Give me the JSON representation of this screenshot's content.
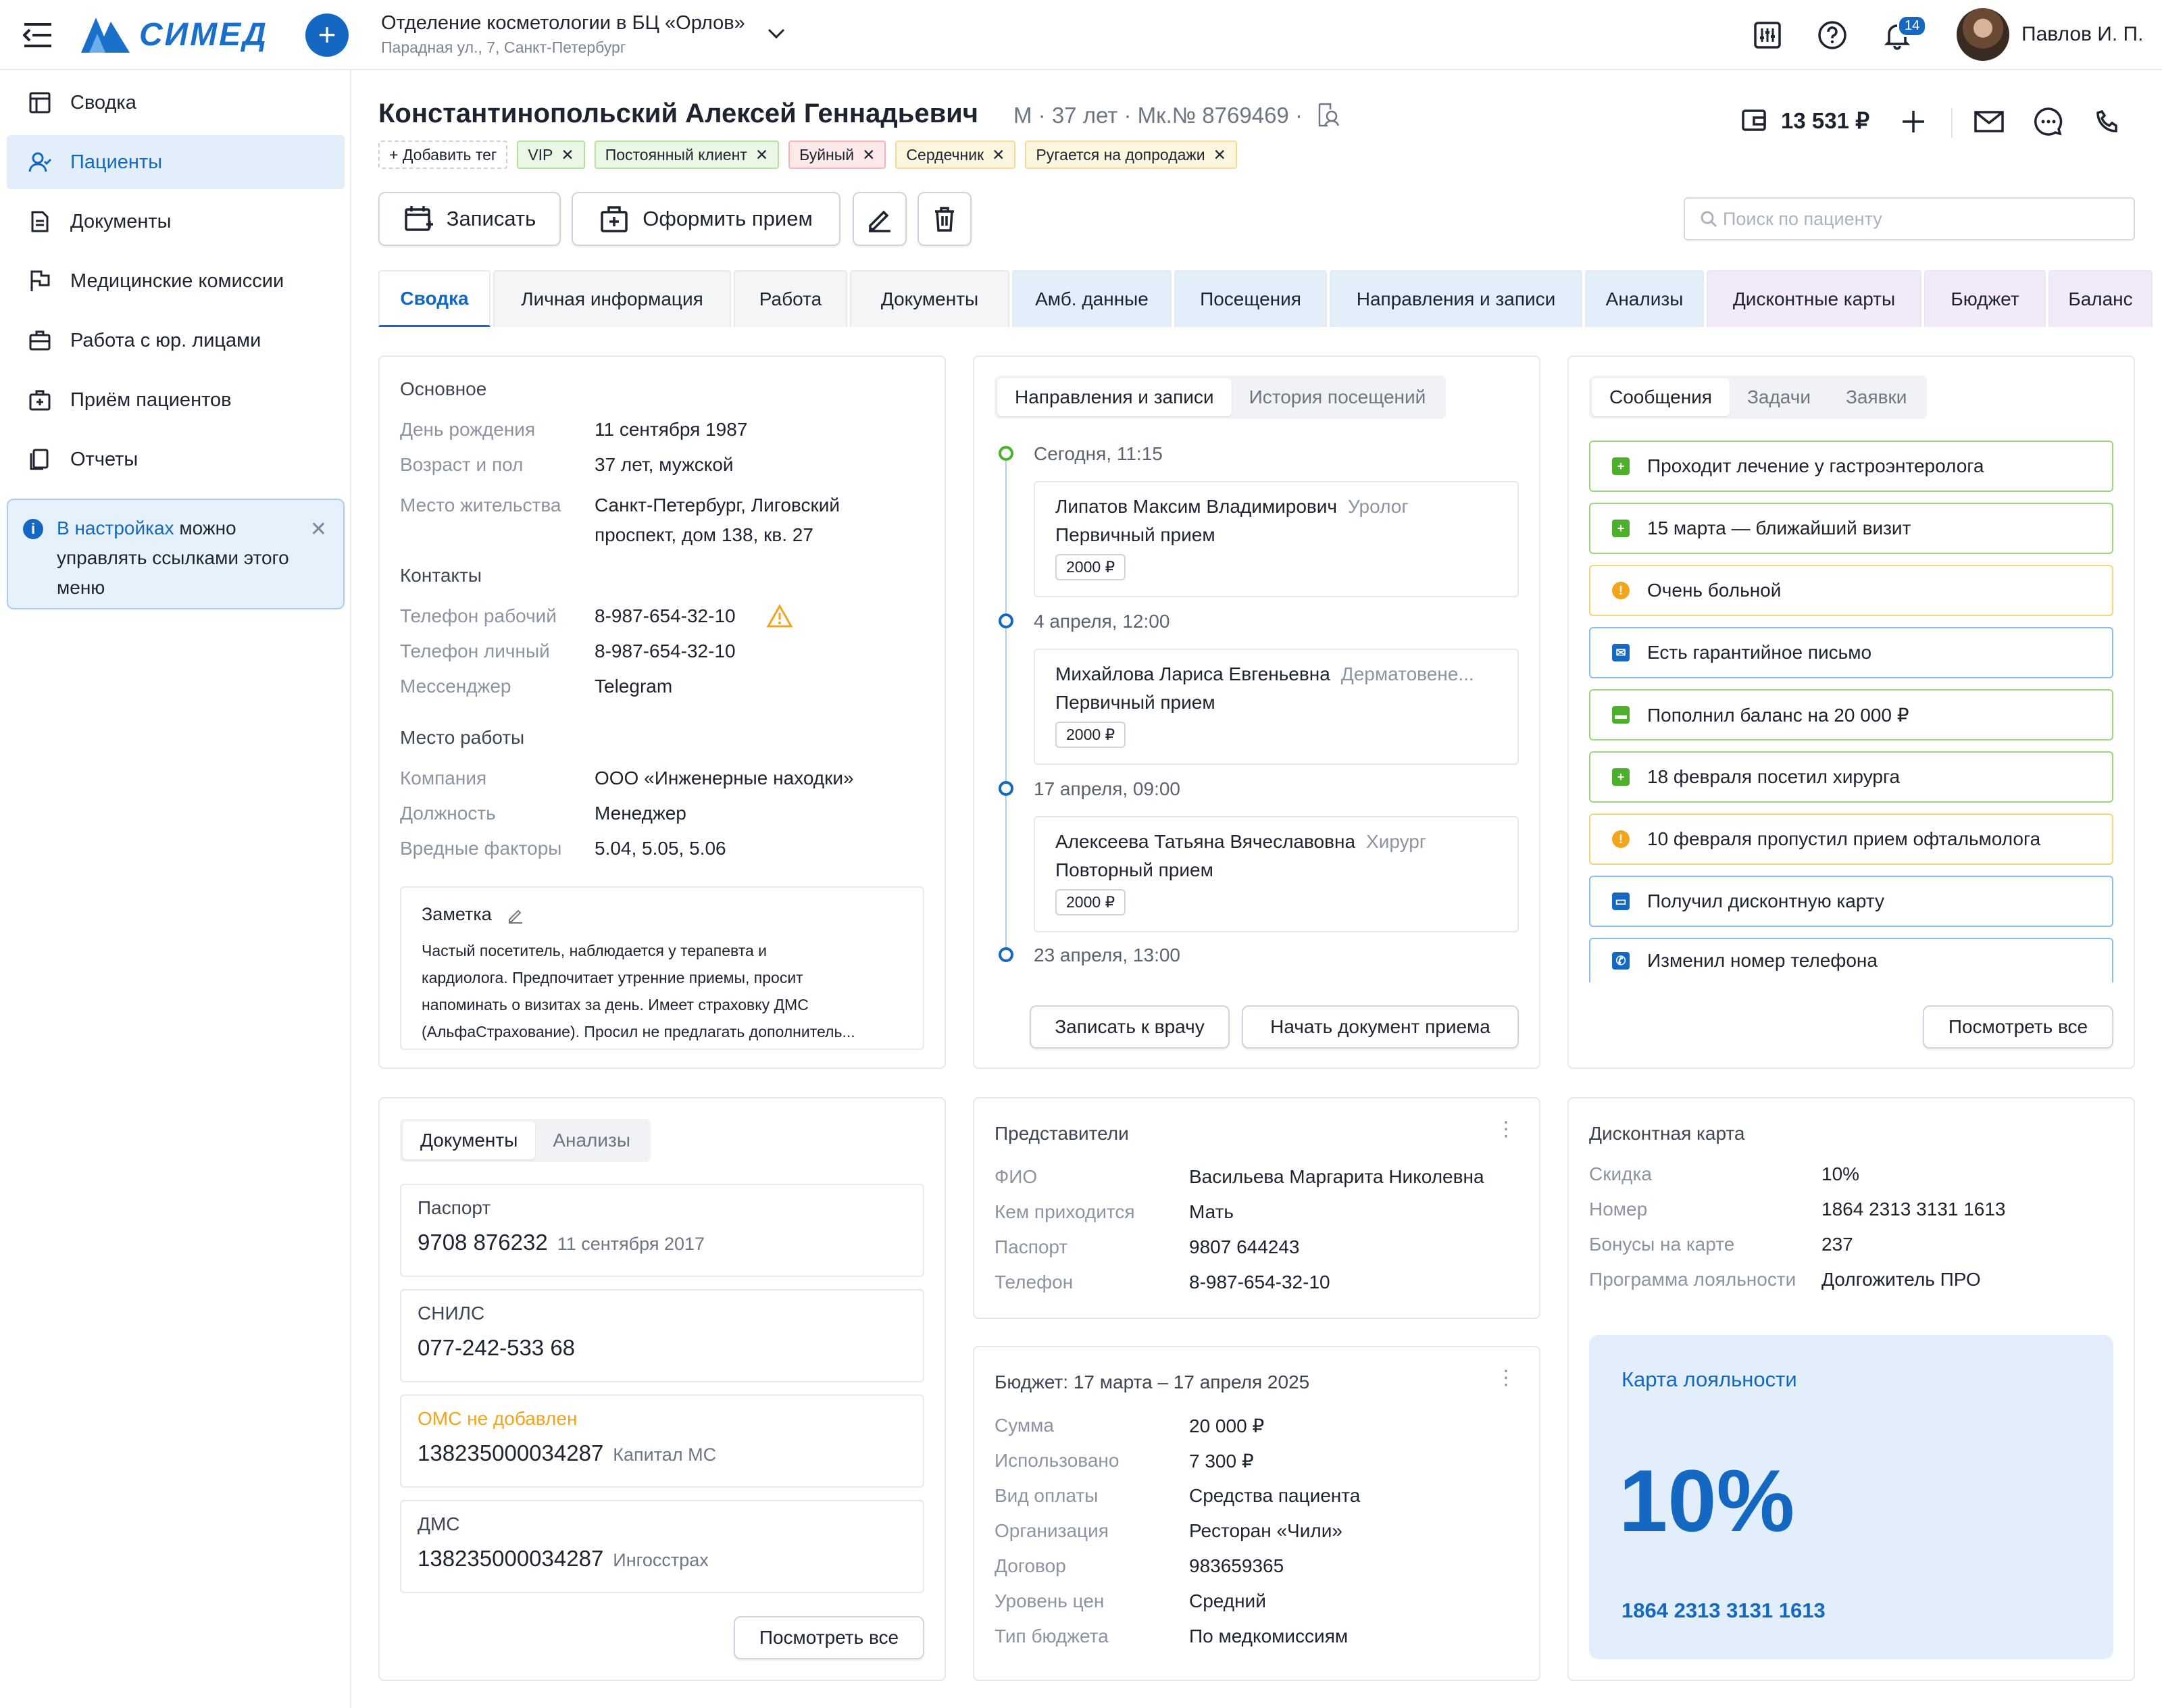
{
  "app": {
    "logo": "СИМЕД"
  },
  "clinic": {
    "name": "Отделение косметологии в БЦ «Орлов»",
    "address": "Парадная ул., 7, Санкт-Петербург"
  },
  "user": {
    "name": "Павлов И. П.",
    "notifications": "14"
  },
  "sidebar": {
    "items": [
      {
        "label": "Сводка",
        "icon": "summary-icon"
      },
      {
        "label": "Пациенты",
        "icon": "patients-icon"
      },
      {
        "label": "Документы",
        "icon": "document-icon"
      },
      {
        "label": "Медицинские комиссии",
        "icon": "flag-icon"
      },
      {
        "label": "Работа с юр. лицами",
        "icon": "briefcase-icon"
      },
      {
        "label": "Приём пациентов",
        "icon": "medical-case-icon"
      },
      {
        "label": "Отчеты",
        "icon": "reports-icon"
      }
    ],
    "hint": {
      "link": "В настройках",
      "text": " можно управлять ссылками этого меню"
    }
  },
  "patient": {
    "name": "Константинопольский Алексей Геннадьевич",
    "meta": "М · 37 лет · Мк.№ 8769469 ·",
    "balance": "13 531 ₽",
    "add_tag": "+ Добавить тег",
    "tags": [
      "VIP",
      "Постоянный клиент",
      "Буйный",
      "Сердечник",
      "Ругается на допродажи"
    ]
  },
  "actions": {
    "book": "Записать",
    "reception": "Оформить прием",
    "search_placeholder": "Поиск по пациенту"
  },
  "tabs": [
    "Сводка",
    "Личная информация",
    "Работа",
    "Документы",
    "Амб. данные",
    "Посещения",
    "Направления и записи",
    "Анализы",
    "Дисконтные карты",
    "Бюджет",
    "Баланс"
  ],
  "basic": {
    "title": "Основное",
    "rows": [
      {
        "k": "День рождения",
        "v": "11 сентября 1987"
      },
      {
        "k": "Возраст и пол",
        "v": "37 лет, мужской"
      },
      {
        "k": "Место жительства",
        "v": "Санкт-Петербург, Лиговский",
        "v2": "проспект, дом 138, кв. 27"
      }
    ],
    "contacts_title": "Контакты",
    "contacts": [
      {
        "k": "Телефон рабочий",
        "v": "8-987-654-32-10"
      },
      {
        "k": "Телефон личный",
        "v": "8-987-654-32-10"
      },
      {
        "k": "Мессенджер",
        "v": "Telegram"
      }
    ],
    "work_title": "Место работы",
    "work": [
      {
        "k": "Компания",
        "v": "ООО «Инженерные находки»"
      },
      {
        "k": "Должность",
        "v": "Менеджер"
      },
      {
        "k": "Вредные факторы",
        "v": "5.04, 5.05, 5.06"
      }
    ],
    "note_title": "Заметка",
    "note_lines": [
      "Частый посетитель, наблюдается у терапевта и",
      "кардиолога. Предпочитает утренние приемы, просит",
      "напоминать о визитах за день. Имеет страховку ДМС",
      "(АльфаСтрахование). Просил не предлагать дополнитель..."
    ]
  },
  "appointments": {
    "tabs": [
      "Направления и записи",
      "История посещений"
    ],
    "items": [
      {
        "date": "Сегодня, 11:15",
        "doctor": "Липатов Максим Владимирович",
        "spec": "Уролог",
        "type": "Первичный прием",
        "price": "2000 ₽"
      },
      {
        "date": "4 апреля, 12:00",
        "doctor": "Михайлова Лариса Евгеньевна",
        "spec": "Дерматовене...",
        "type": "Первичный прием",
        "price": "2000 ₽"
      },
      {
        "date": "17 апреля, 09:00",
        "doctor": "Алексеева Татьяна Вячеславовна",
        "spec": "Хирург",
        "type": "Повторный прием",
        "price": "2000 ₽"
      },
      {
        "date": "23 апреля, 13:00"
      }
    ],
    "btn_book": "Записать к врачу",
    "btn_start": "Начать документ приема"
  },
  "messages": {
    "tabs": [
      "Сообщения",
      "Задачи",
      "Заявки"
    ],
    "items": [
      {
        "text": "Проходит лечение у гастроэнтеролога",
        "status": "green",
        "icon": "medical-bag-icon",
        "color": "#4cb02d"
      },
      {
        "text": "15 марта — ближайший визит",
        "status": "green",
        "icon": "medical-bag-icon",
        "color": "#4cb02d"
      },
      {
        "text": "Очень больной",
        "status": "yellow",
        "icon": "warning-icon",
        "color": "#f2a41c"
      },
      {
        "text": "Есть гарантийное письмо",
        "status": "blue",
        "icon": "envelope-icon",
        "color": "#1468c2"
      },
      {
        "text": "Пополнил баланс на 20 000 ₽",
        "status": "green",
        "icon": "wallet-icon",
        "color": "#4cb02d"
      },
      {
        "text": "18 февраля посетил хирурга",
        "status": "green",
        "icon": "medical-bag-icon",
        "color": "#4cb02d"
      },
      {
        "text": "10 февраля пропустил прием офтальмолога",
        "status": "yellow",
        "icon": "warning-icon",
        "color": "#f2a41c"
      },
      {
        "text": "Получил дисконтную карту",
        "status": "blue",
        "icon": "card-icon",
        "color": "#1468c2"
      },
      {
        "text": "Изменил номер телефона",
        "status": "blue",
        "icon": "phone-icon",
        "color": "#1468c2"
      }
    ],
    "view_all": "Посмотреть все"
  },
  "documents": {
    "tabs": [
      "Документы",
      "Анализы"
    ],
    "items": [
      {
        "title": "Паспорт",
        "value": "9708 876232",
        "sub": "11 сентября 2017"
      },
      {
        "title": "СНИЛС",
        "value": "077-242-533 68",
        "sub": ""
      },
      {
        "title": "ОМС не добавлен",
        "value": "138235000034287",
        "sub": "Капитал МС",
        "warn": true
      },
      {
        "title": "ДМС",
        "value": "138235000034287",
        "sub": "Ингосстрах"
      }
    ],
    "view_all": "Посмотреть все"
  },
  "representatives": {
    "title": "Представители",
    "rows": [
      {
        "k": "ФИО",
        "v": "Васильева Маргарита Николевна"
      },
      {
        "k": "Кем приходится",
        "v": "Мать"
      },
      {
        "k": "Паспорт",
        "v": "9807 644243"
      },
      {
        "k": "Телефон",
        "v": "8-987-654-32-10"
      }
    ]
  },
  "budget": {
    "title": "Бюджет: 17 марта – 17 апреля 2025",
    "rows": [
      {
        "k": "Сумма",
        "v": "20 000 ₽"
      },
      {
        "k": "Использовано",
        "v": "7 300 ₽"
      },
      {
        "k": "Вид оплаты",
        "v": "Средства пациента"
      },
      {
        "k": "Организация",
        "v": "Ресторан «Чили»"
      },
      {
        "k": "Договор",
        "v": "983659365"
      },
      {
        "k": "Уровень цен",
        "v": "Средний"
      },
      {
        "k": "Тип бюджета",
        "v": "По медкомиссиям"
      }
    ]
  },
  "discount": {
    "title": "Дисконтная карта",
    "rows": [
      {
        "k": "Скидка",
        "v": "10%"
      },
      {
        "k": "Номер",
        "v": "1864 2313 3131 1613"
      },
      {
        "k": "Бонусы на карте",
        "v": "237"
      },
      {
        "k": "Программа лояльности",
        "v": "Долгожитель ПРО",
        "link": true
      }
    ],
    "card_title": "Карта лояльности",
    "card_percent": "10%",
    "card_number": "1864 2313 3131 1613"
  }
}
